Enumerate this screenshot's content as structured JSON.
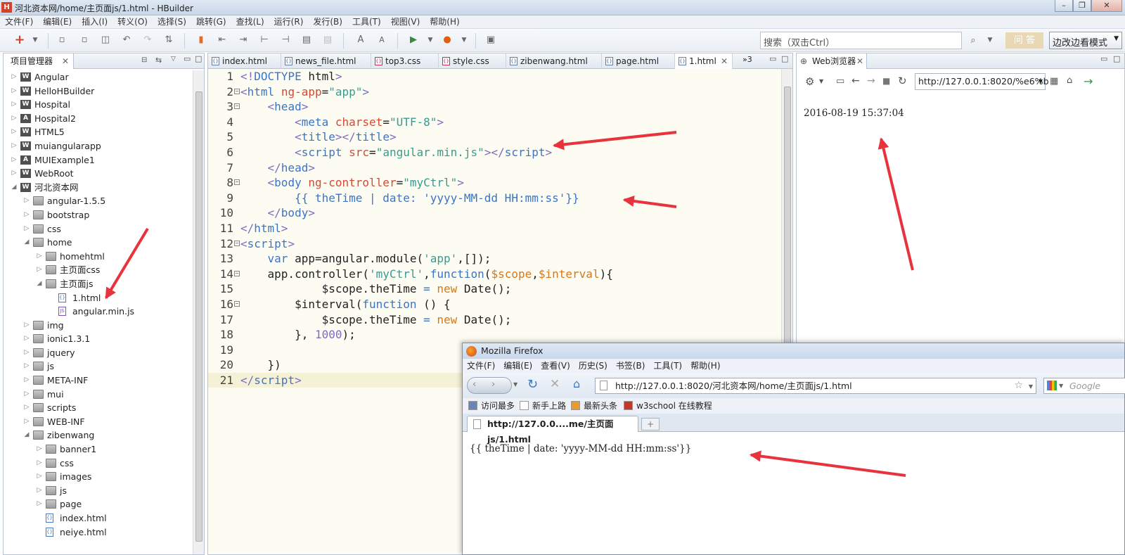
{
  "window": {
    "title": "河北资本网/home/主页面js/1.html  - HBuilder",
    "app_icon": "H"
  },
  "menu": [
    "文件(F)",
    "编辑(E)",
    "插入(I)",
    "转义(O)",
    "选择(S)",
    "跳转(G)",
    "查找(L)",
    "运行(R)",
    "发行(B)",
    "工具(T)",
    "视图(V)",
    "帮助(H)"
  ],
  "toolbar": {
    "search_placeholder": "搜索（双击Ctrl）",
    "ask_label": "问 答",
    "mode_label": "边改边看模式"
  },
  "project_panel": {
    "title": "项目管理器",
    "tree": [
      {
        "label": "Angular",
        "depth": 0,
        "icon": "w",
        "expanded": false
      },
      {
        "label": "HelloHBuilder",
        "depth": 0,
        "icon": "w",
        "expanded": false
      },
      {
        "label": "Hospital",
        "depth": 0,
        "icon": "w",
        "expanded": false
      },
      {
        "label": "Hospital2",
        "depth": 0,
        "icon": "a",
        "expanded": false
      },
      {
        "label": "HTML5",
        "depth": 0,
        "icon": "w",
        "expanded": false
      },
      {
        "label": "muiangularapp",
        "depth": 0,
        "icon": "w",
        "expanded": false
      },
      {
        "label": "MUIExample1",
        "depth": 0,
        "icon": "a",
        "expanded": false
      },
      {
        "label": "WebRoot",
        "depth": 0,
        "icon": "w",
        "expanded": false
      },
      {
        "label": "河北资本网",
        "depth": 0,
        "icon": "w",
        "expanded": true
      },
      {
        "label": "angular-1.5.5",
        "depth": 1,
        "icon": "folder",
        "expanded": false
      },
      {
        "label": "bootstrap",
        "depth": 1,
        "icon": "folder",
        "expanded": false
      },
      {
        "label": "css",
        "depth": 1,
        "icon": "folder",
        "expanded": false
      },
      {
        "label": "home",
        "depth": 1,
        "icon": "folder",
        "expanded": true
      },
      {
        "label": "homehtml",
        "depth": 2,
        "icon": "folder",
        "expanded": false
      },
      {
        "label": "主页面css",
        "depth": 2,
        "icon": "folder",
        "expanded": false
      },
      {
        "label": "主页面js",
        "depth": 2,
        "icon": "folder",
        "expanded": true
      },
      {
        "label": "1.html",
        "depth": 3,
        "icon": "html",
        "expanded": null
      },
      {
        "label": "angular.min.js",
        "depth": 3,
        "icon": "js",
        "expanded": null
      },
      {
        "label": "img",
        "depth": 1,
        "icon": "folder",
        "expanded": false
      },
      {
        "label": "ionic1.3.1",
        "depth": 1,
        "icon": "folder",
        "expanded": false
      },
      {
        "label": "jquery",
        "depth": 1,
        "icon": "folder",
        "expanded": false
      },
      {
        "label": "js",
        "depth": 1,
        "icon": "folder",
        "expanded": false
      },
      {
        "label": "META-INF",
        "depth": 1,
        "icon": "folder",
        "expanded": false
      },
      {
        "label": "mui",
        "depth": 1,
        "icon": "folder",
        "expanded": false
      },
      {
        "label": "scripts",
        "depth": 1,
        "icon": "folder",
        "expanded": false
      },
      {
        "label": "WEB-INF",
        "depth": 1,
        "icon": "folder",
        "expanded": false
      },
      {
        "label": "zibenwang",
        "depth": 1,
        "icon": "folder",
        "expanded": true
      },
      {
        "label": "banner1",
        "depth": 2,
        "icon": "folder",
        "expanded": false
      },
      {
        "label": "css",
        "depth": 2,
        "icon": "folder",
        "expanded": false
      },
      {
        "label": "images",
        "depth": 2,
        "icon": "folder",
        "expanded": false
      },
      {
        "label": "js",
        "depth": 2,
        "icon": "folder",
        "expanded": false
      },
      {
        "label": "page",
        "depth": 2,
        "icon": "folder",
        "expanded": false
      },
      {
        "label": "index.html",
        "depth": 2,
        "icon": "html",
        "expanded": null
      },
      {
        "label": "neiye.html",
        "depth": 2,
        "icon": "html",
        "expanded": null
      }
    ]
  },
  "editor": {
    "tabs": [
      {
        "label": "index.html",
        "kind": "html",
        "active": false
      },
      {
        "label": "news_file.html",
        "kind": "html",
        "active": false
      },
      {
        "label": "top3.css",
        "kind": "css",
        "active": false
      },
      {
        "label": "style.css",
        "kind": "css",
        "active": false
      },
      {
        "label": "zibenwang.html",
        "kind": "html",
        "active": false
      },
      {
        "label": "page.html",
        "kind": "html",
        "active": false
      },
      {
        "label": "1.html",
        "kind": "html",
        "active": true
      }
    ],
    "overflow_label": "»3",
    "lines": [
      {
        "n": "1",
        "fold": false,
        "t": [
          [
            "pu",
            "<!"
          ],
          [
            "tg",
            "DOCTYPE"
          ],
          [
            "df",
            " html"
          ],
          [
            "pu",
            ">"
          ]
        ]
      },
      {
        "n": "2",
        "fold": true,
        "t": [
          [
            "pu",
            "<"
          ],
          [
            "tg",
            "html"
          ],
          [
            "df",
            " "
          ],
          [
            "at",
            "ng-app"
          ],
          [
            "df",
            "="
          ],
          [
            "st",
            "\"app\""
          ],
          [
            "pu",
            ">"
          ]
        ]
      },
      {
        "n": "3",
        "fold": true,
        "t": [
          [
            "df",
            "    "
          ],
          [
            "pu",
            "<"
          ],
          [
            "tg",
            "head"
          ],
          [
            "pu",
            ">"
          ]
        ]
      },
      {
        "n": "4",
        "fold": false,
        "t": [
          [
            "df",
            "        "
          ],
          [
            "pu",
            "<"
          ],
          [
            "tg",
            "meta"
          ],
          [
            "df",
            " "
          ],
          [
            "at",
            "charset"
          ],
          [
            "df",
            "="
          ],
          [
            "st",
            "\"UTF-8\""
          ],
          [
            "pu",
            ">"
          ]
        ]
      },
      {
        "n": "5",
        "fold": false,
        "t": [
          [
            "df",
            "        "
          ],
          [
            "pu",
            "<"
          ],
          [
            "tg",
            "title"
          ],
          [
            "pu",
            "></"
          ],
          [
            "tg",
            "title"
          ],
          [
            "pu",
            ">"
          ]
        ]
      },
      {
        "n": "6",
        "fold": false,
        "t": [
          [
            "df",
            "        "
          ],
          [
            "pu",
            "<"
          ],
          [
            "tg",
            "script"
          ],
          [
            "df",
            " "
          ],
          [
            "at",
            "src"
          ],
          [
            "df",
            "="
          ],
          [
            "st",
            "\"angular.min.js\""
          ],
          [
            "pu",
            "></"
          ],
          [
            "tg",
            "script"
          ],
          [
            "pu",
            ">"
          ]
        ]
      },
      {
        "n": "7",
        "fold": false,
        "t": [
          [
            "df",
            "    "
          ],
          [
            "pu",
            "</"
          ],
          [
            "tg",
            "head"
          ],
          [
            "pu",
            ">"
          ]
        ]
      },
      {
        "n": "8",
        "fold": true,
        "t": [
          [
            "df",
            "    "
          ],
          [
            "pu",
            "<"
          ],
          [
            "tg",
            "body"
          ],
          [
            "df",
            " "
          ],
          [
            "at",
            "ng-controller"
          ],
          [
            "df",
            "="
          ],
          [
            "st",
            "\"myCtrl\""
          ],
          [
            "pu",
            ">"
          ]
        ]
      },
      {
        "n": "9",
        "fold": false,
        "t": [
          [
            "df",
            "        "
          ],
          [
            "tg",
            "{{ theTime | date: 'yyyy-MM-dd HH:mm:ss'}}"
          ]
        ]
      },
      {
        "n": "10",
        "fold": false,
        "t": [
          [
            "df",
            "    "
          ],
          [
            "pu",
            "</"
          ],
          [
            "tg",
            "body"
          ],
          [
            "pu",
            ">"
          ]
        ]
      },
      {
        "n": "11",
        "fold": false,
        "t": [
          [
            "pu",
            "</"
          ],
          [
            "tg",
            "html"
          ],
          [
            "pu",
            ">"
          ]
        ]
      },
      {
        "n": "12",
        "fold": true,
        "t": [
          [
            "pu",
            "<"
          ],
          [
            "tg",
            "script"
          ],
          [
            "pu",
            ">"
          ]
        ]
      },
      {
        "n": "13",
        "fold": false,
        "t": [
          [
            "df",
            "    "
          ],
          [
            "kw",
            "var"
          ],
          [
            "df",
            " app=angular.module("
          ],
          [
            "st",
            "'app'"
          ],
          [
            "df",
            ",[]);"
          ]
        ]
      },
      {
        "n": "14",
        "fold": true,
        "t": [
          [
            "df",
            "    app.controller("
          ],
          [
            "st",
            "'myCtrl'"
          ],
          [
            "df",
            ","
          ],
          [
            "kw",
            "function"
          ],
          [
            "df",
            "("
          ],
          [
            "vr",
            "$scope"
          ],
          [
            "df",
            ","
          ],
          [
            "vr",
            "$interval"
          ],
          [
            "df",
            "){"
          ]
        ]
      },
      {
        "n": "15",
        "fold": false,
        "t": [
          [
            "df",
            "            $scope.theTime "
          ],
          [
            "kw",
            "="
          ],
          [
            "df",
            " "
          ],
          [
            "vr",
            "new"
          ],
          [
            "df",
            " Date();"
          ]
        ]
      },
      {
        "n": "16",
        "fold": true,
        "t": [
          [
            "df",
            "        $interval("
          ],
          [
            "kw",
            "function"
          ],
          [
            "df",
            " () {"
          ]
        ]
      },
      {
        "n": "17",
        "fold": false,
        "t": [
          [
            "df",
            "            $scope.theTime "
          ],
          [
            "kw",
            "="
          ],
          [
            "df",
            " "
          ],
          [
            "vr",
            "new"
          ],
          [
            "df",
            " Date();"
          ]
        ]
      },
      {
        "n": "18",
        "fold": false,
        "t": [
          [
            "df",
            "        }, "
          ],
          [
            "nm",
            "1000"
          ],
          [
            "df",
            ");"
          ]
        ]
      },
      {
        "n": "19",
        "fold": false,
        "t": [
          [
            "df",
            ""
          ]
        ]
      },
      {
        "n": "20",
        "fold": false,
        "t": [
          [
            "df",
            "    })"
          ]
        ]
      },
      {
        "n": "21",
        "fold": false,
        "t": [
          [
            "pu",
            "</"
          ],
          [
            "tg",
            "script"
          ],
          [
            "pu",
            ">"
          ]
        ]
      }
    ]
  },
  "web_browser": {
    "tab_label": "Web浏览器",
    "url": "http://127.0.0.1:8020/%e6%b",
    "content": "2016-08-19 15:37:04"
  },
  "firefox": {
    "title": "Mozilla Firefox",
    "menu": [
      "文件(F)",
      "编辑(E)",
      "查看(V)",
      "历史(S)",
      "书签(B)",
      "工具(T)",
      "帮助(H)"
    ],
    "url": "http://127.0.0.1:8020/河北资本网/home/主页面js/1.html",
    "search_placeholder": "Google",
    "bookmarks": [
      "访问最多",
      "新手上路",
      "最新头条",
      "w3school 在线教程"
    ],
    "tab_label": "http://127.0.0....me/主页面js/1.html",
    "content": "{{ theTime | date: 'yyyy-MM-dd HH:mm:ss'}}"
  },
  "annotation_color": "#e8323c"
}
